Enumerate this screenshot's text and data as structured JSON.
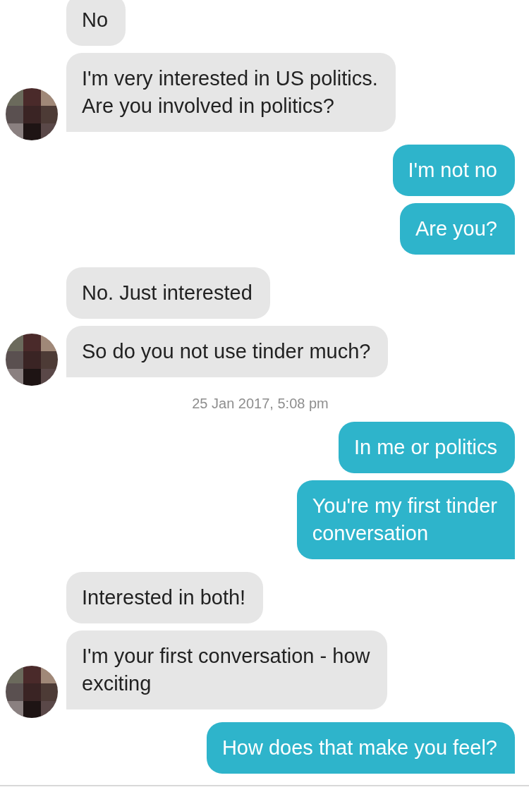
{
  "messages": [
    {
      "kind": "received",
      "text": "No",
      "avatar": false,
      "tail": false
    },
    {
      "kind": "received",
      "text": "I'm very interested in US politics.\nAre you involved in politics?",
      "avatar": true,
      "tail": true
    },
    {
      "kind": "sent",
      "text": "I'm not no",
      "tail": false
    },
    {
      "kind": "sent",
      "text": "Are you?",
      "tail": true
    },
    {
      "kind": "received",
      "text": "No. Just interested",
      "avatar": false,
      "tail": false
    },
    {
      "kind": "received",
      "text": "So do you not use tinder much?",
      "avatar": true,
      "tail": true
    },
    {
      "kind": "timestamp",
      "text": "25 Jan 2017, 5:08 pm"
    },
    {
      "kind": "sent",
      "text": "In me or politics",
      "tail": false
    },
    {
      "kind": "sent",
      "text": "You're my first tinder\nconversation",
      "tail": true
    },
    {
      "kind": "received",
      "text": "Interested in both!",
      "avatar": false,
      "tail": false
    },
    {
      "kind": "received",
      "text": "I'm your first conversation - how\nexciting",
      "avatar": true,
      "tail": true
    },
    {
      "kind": "sent",
      "text": "How does that make you feel?",
      "tail": true
    }
  ]
}
